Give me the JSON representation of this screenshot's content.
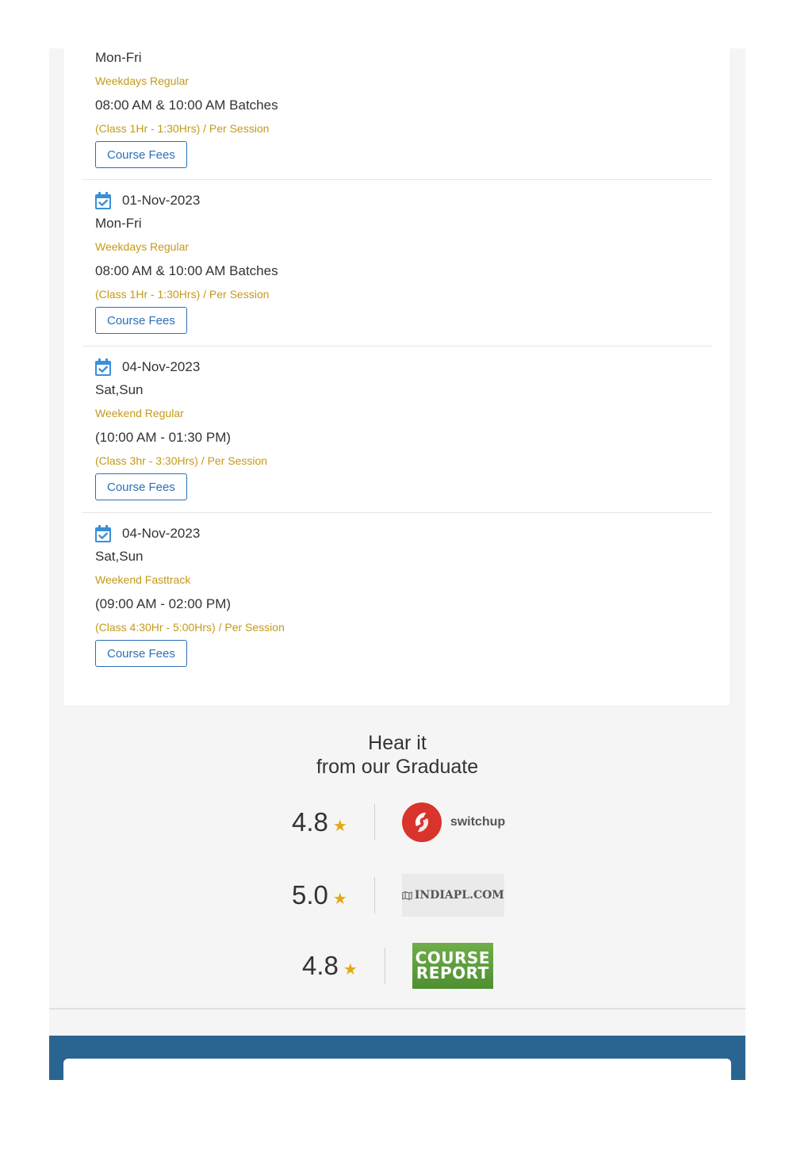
{
  "batches": [
    {
      "date": "",
      "days": "Mon-Fri",
      "type": "Weekdays Regular",
      "time": "08:00 AM & 10:00 AM Batches",
      "duration": "(Class 1Hr - 1:30Hrs) / Per Session",
      "button": "Course Fees"
    },
    {
      "date": "01-Nov-2023",
      "days": "Mon-Fri",
      "type": "Weekdays Regular",
      "time": "08:00 AM & 10:00 AM Batches",
      "duration": "(Class 1Hr - 1:30Hrs) / Per Session",
      "button": "Course Fees"
    },
    {
      "date": "04-Nov-2023",
      "days": "Sat,Sun",
      "type": "Weekend Regular",
      "time": "(10:00 AM - 01:30 PM)",
      "duration": "(Class 3hr - 3:30Hrs) / Per Session",
      "button": "Course Fees"
    },
    {
      "date": "04-Nov-2023",
      "days": "Sat,Sun",
      "type": "Weekend Fasttrack",
      "time": "(09:00 AM - 02:00 PM)",
      "duration": "(Class 4:30Hr - 5:00Hrs) / Per Session",
      "button": "Course Fees"
    }
  ],
  "reviews": {
    "heading_line1": "Hear it",
    "heading_line2": "from our Graduate",
    "items": [
      {
        "score": "4.8",
        "source": "switchup",
        "logo_text": "switchup"
      },
      {
        "score": "5.0",
        "source": "indiapl",
        "logo_text": "INDIAPL.COM"
      },
      {
        "score": "4.8",
        "source": "course-report",
        "logo_text_line1": "COURSE",
        "logo_text_line2": "REPORT"
      }
    ]
  },
  "colors": {
    "accent_blue": "#2a6fb8",
    "gold": "#c49a1a",
    "star": "#e5a812",
    "footer": "#2a6592",
    "switchup_red": "#d9342b",
    "course_report_green": "#5a9e3a"
  }
}
